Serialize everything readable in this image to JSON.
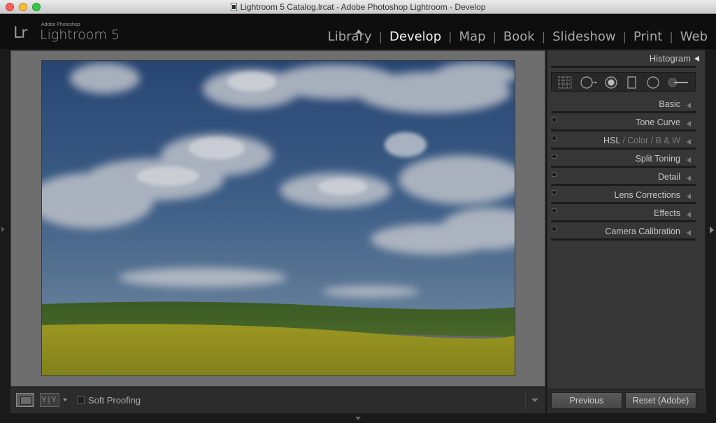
{
  "window": {
    "title": "Lightroom 5 Catalog.lrcat - Adobe Photoshop Lightroom - Develop"
  },
  "identity": {
    "vendor": "Adobe Photoshop",
    "product": "Lightroom 5",
    "mark": "Lr"
  },
  "modules": {
    "items": [
      {
        "label": "Library",
        "active": false
      },
      {
        "label": "Develop",
        "active": true
      },
      {
        "label": "Map",
        "active": false
      },
      {
        "label": "Book",
        "active": false
      },
      {
        "label": "Slideshow",
        "active": false
      },
      {
        "label": "Print",
        "active": false
      },
      {
        "label": "Web",
        "active": false
      }
    ]
  },
  "right_panel": {
    "histogram_label": "Histogram",
    "tools": [
      "grid-overlay-icon",
      "crop-icon",
      "spot-removal-icon",
      "graduated-filter-icon",
      "radial-filter-icon",
      "adjustment-brush-icon"
    ],
    "panels": [
      {
        "label": "Basic",
        "has_switch": false
      },
      {
        "label": "Tone Curve",
        "has_switch": true
      },
      {
        "label": "HSL",
        "label2": "Color",
        "label3": "B & W",
        "has_switch": true
      },
      {
        "label": "Split Toning",
        "has_switch": true
      },
      {
        "label": "Detail",
        "has_switch": true
      },
      {
        "label": "Lens Corrections",
        "has_switch": true
      },
      {
        "label": "Effects",
        "has_switch": true
      },
      {
        "label": "Camera Calibration",
        "has_switch": true
      }
    ],
    "previous_button": "Previous",
    "reset_button": "Reset (Adobe)"
  },
  "toolbar": {
    "yy_label": "Y|Y",
    "soft_proofing_label": "Soft Proofing",
    "soft_proofing_checked": false
  },
  "colors": {
    "accent_active": "#f0f0f0",
    "panel_bg": "#363636"
  }
}
